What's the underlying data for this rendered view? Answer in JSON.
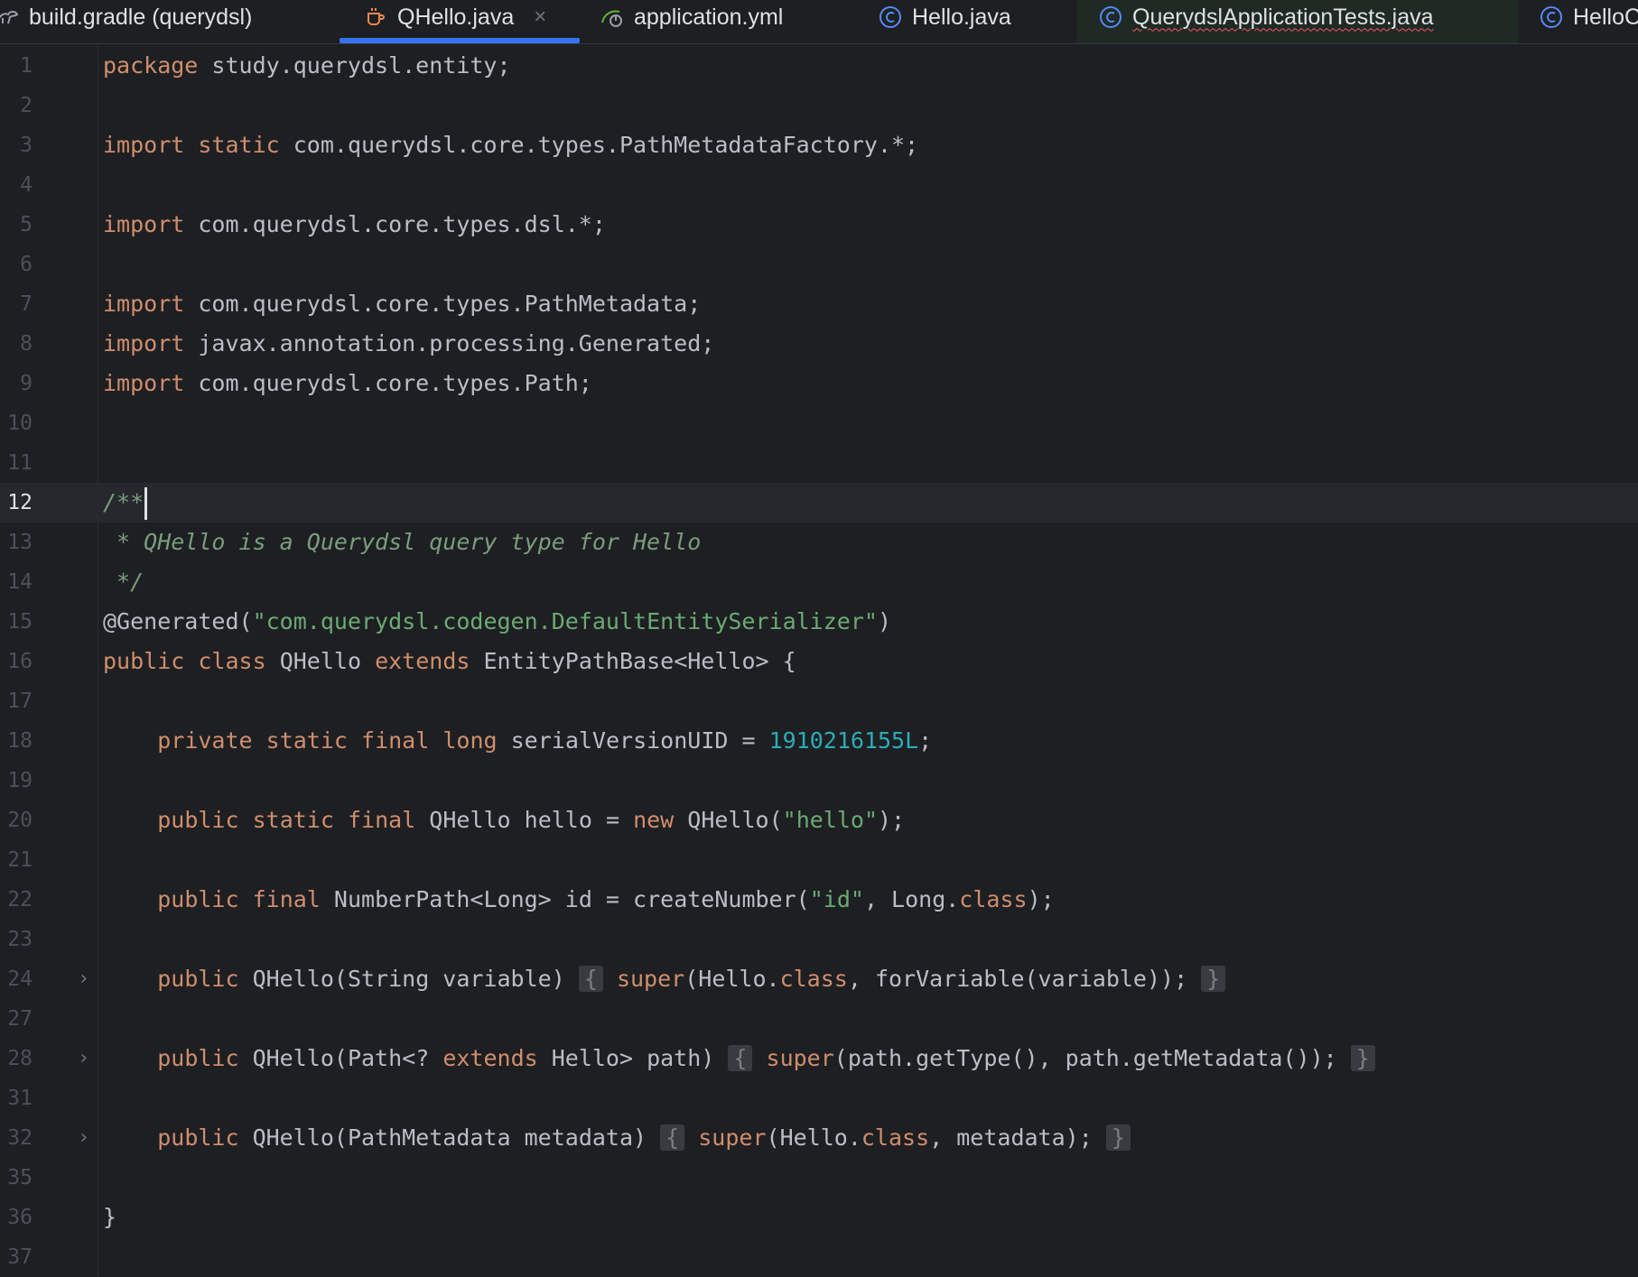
{
  "tabs": [
    {
      "label": "build.gradle (querydsl)",
      "icon": "gradle-icon"
    },
    {
      "label": "QHello.java",
      "icon": "java-file-icon",
      "active": true
    },
    {
      "label": "application.yml",
      "icon": "spring-config-icon"
    },
    {
      "label": "Hello.java",
      "icon": "java-class-icon"
    },
    {
      "label": "QuerydslApplicationTests.java",
      "icon": "java-class-icon"
    },
    {
      "label": "HelloC",
      "icon": "java-class-icon"
    }
  ],
  "close_glyph": "×",
  "fold_glyph": "›",
  "current_line": "12",
  "lines": [
    {
      "n": "1",
      "tokens": [
        {
          "t": "package",
          "c": "kw"
        },
        {
          "t": " study.querydsl.entity;"
        }
      ]
    },
    {
      "n": "2",
      "tokens": []
    },
    {
      "n": "3",
      "tokens": [
        {
          "t": "import",
          "c": "kw"
        },
        {
          "t": " "
        },
        {
          "t": "static",
          "c": "kw"
        },
        {
          "t": " com.querydsl.core.types.PathMetadataFactory.*;"
        }
      ]
    },
    {
      "n": "4",
      "tokens": []
    },
    {
      "n": "5",
      "tokens": [
        {
          "t": "import",
          "c": "kw"
        },
        {
          "t": " com.querydsl.core.types.dsl.*;"
        }
      ]
    },
    {
      "n": "6",
      "tokens": []
    },
    {
      "n": "7",
      "tokens": [
        {
          "t": "import",
          "c": "kw"
        },
        {
          "t": " com.querydsl.core.types.PathMetadata;"
        }
      ]
    },
    {
      "n": "8",
      "tokens": [
        {
          "t": "import",
          "c": "kw"
        },
        {
          "t": " javax.annotation.processing.Generated;"
        }
      ]
    },
    {
      "n": "9",
      "tokens": [
        {
          "t": "import",
          "c": "kw"
        },
        {
          "t": " com.querydsl.core.types.Path;"
        }
      ]
    },
    {
      "n": "10",
      "tokens": []
    },
    {
      "n": "11",
      "tokens": []
    },
    {
      "n": "12",
      "tokens": [
        {
          "t": "/**",
          "c": "cmt"
        }
      ],
      "caret": true
    },
    {
      "n": "13",
      "tokens": [
        {
          "t": " * QHello is a Querydsl query type for Hello",
          "c": "cmt"
        }
      ]
    },
    {
      "n": "14",
      "tokens": [
        {
          "t": " */",
          "c": "cmt"
        }
      ]
    },
    {
      "n": "15",
      "tokens": [
        {
          "t": "@Generated(",
          "c": "ann"
        },
        {
          "t": "\"com.querydsl.codegen.DefaultEntitySerializer\"",
          "c": "str"
        },
        {
          "t": ")"
        }
      ]
    },
    {
      "n": "16",
      "tokens": [
        {
          "t": "public",
          "c": "kw"
        },
        {
          "t": " "
        },
        {
          "t": "class",
          "c": "kw"
        },
        {
          "t": " QHello "
        },
        {
          "t": "extends",
          "c": "kw"
        },
        {
          "t": " EntityPathBase<Hello> {"
        }
      ]
    },
    {
      "n": "17",
      "tokens": []
    },
    {
      "n": "18",
      "tokens": [
        {
          "t": "    "
        },
        {
          "t": "private",
          "c": "kw"
        },
        {
          "t": " "
        },
        {
          "t": "static",
          "c": "kw"
        },
        {
          "t": " "
        },
        {
          "t": "final",
          "c": "kw"
        },
        {
          "t": " "
        },
        {
          "t": "long",
          "c": "kw"
        },
        {
          "t": " serialVersionUID = "
        },
        {
          "t": "1910216155L",
          "c": "num"
        },
        {
          "t": ";"
        }
      ]
    },
    {
      "n": "19",
      "tokens": []
    },
    {
      "n": "20",
      "tokens": [
        {
          "t": "    "
        },
        {
          "t": "public",
          "c": "kw"
        },
        {
          "t": " "
        },
        {
          "t": "static",
          "c": "kw"
        },
        {
          "t": " "
        },
        {
          "t": "final",
          "c": "kw"
        },
        {
          "t": " QHello hello = "
        },
        {
          "t": "new",
          "c": "kw"
        },
        {
          "t": " QHello("
        },
        {
          "t": "\"hello\"",
          "c": "str"
        },
        {
          "t": ");"
        }
      ]
    },
    {
      "n": "21",
      "tokens": []
    },
    {
      "n": "22",
      "tokens": [
        {
          "t": "    "
        },
        {
          "t": "public",
          "c": "kw"
        },
        {
          "t": " "
        },
        {
          "t": "final",
          "c": "kw"
        },
        {
          "t": " NumberPath<Long> id = createNumber("
        },
        {
          "t": "\"id\"",
          "c": "str"
        },
        {
          "t": ", Long."
        },
        {
          "t": "class",
          "c": "kw"
        },
        {
          "t": ");"
        }
      ]
    },
    {
      "n": "23",
      "tokens": []
    },
    {
      "n": "24",
      "fold": true,
      "tokens": [
        {
          "t": "    "
        },
        {
          "t": "public",
          "c": "kw"
        },
        {
          "t": " QHello(String variable) "
        },
        {
          "t": "{",
          "c": "brace"
        },
        {
          "t": " "
        },
        {
          "t": "super",
          "c": "kw"
        },
        {
          "t": "(Hello."
        },
        {
          "t": "class",
          "c": "kw"
        },
        {
          "t": ", forVariable(variable)); "
        },
        {
          "t": "}",
          "c": "brace"
        }
      ]
    },
    {
      "n": "27",
      "tokens": []
    },
    {
      "n": "28",
      "fold": true,
      "tokens": [
        {
          "t": "    "
        },
        {
          "t": "public",
          "c": "kw"
        },
        {
          "t": " QHello(Path<? "
        },
        {
          "t": "extends",
          "c": "kw"
        },
        {
          "t": " Hello> path) "
        },
        {
          "t": "{",
          "c": "brace"
        },
        {
          "t": " "
        },
        {
          "t": "super",
          "c": "kw"
        },
        {
          "t": "(path.getType(), path.getMetadata()); "
        },
        {
          "t": "}",
          "c": "brace"
        }
      ]
    },
    {
      "n": "31",
      "tokens": []
    },
    {
      "n": "32",
      "fold": true,
      "tokens": [
        {
          "t": "    "
        },
        {
          "t": "public",
          "c": "kw"
        },
        {
          "t": " QHello(PathMetadata metadata) "
        },
        {
          "t": "{",
          "c": "brace"
        },
        {
          "t": " "
        },
        {
          "t": "super",
          "c": "kw"
        },
        {
          "t": "(Hello."
        },
        {
          "t": "class",
          "c": "kw"
        },
        {
          "t": ", metadata); "
        },
        {
          "t": "}",
          "c": "brace"
        }
      ]
    },
    {
      "n": "35",
      "tokens": []
    },
    {
      "n": "36",
      "tokens": [
        {
          "t": "}"
        }
      ]
    },
    {
      "n": "37",
      "tokens": []
    }
  ]
}
